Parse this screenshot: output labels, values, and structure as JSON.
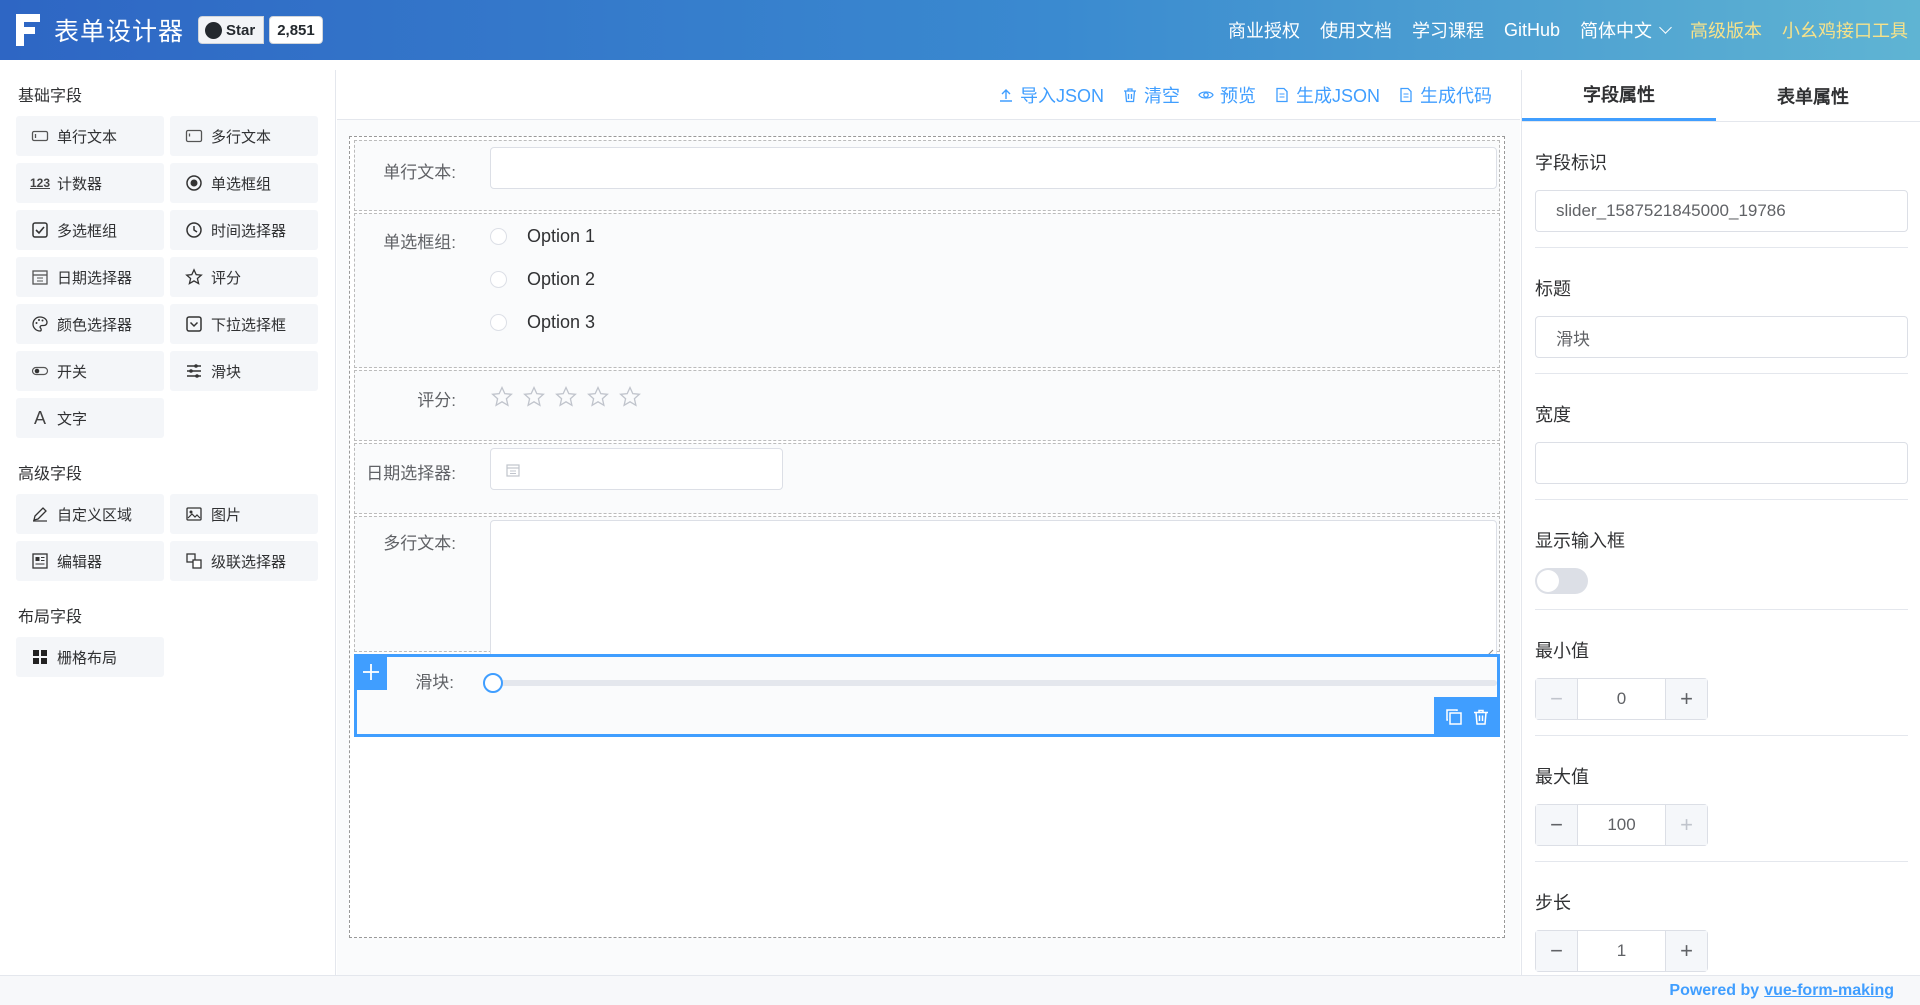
{
  "header": {
    "title": "表单设计器",
    "star_label": "Star",
    "star_count": "2,851",
    "nav": [
      "商业授权",
      "使用文档",
      "学习课程",
      "GitHub"
    ],
    "language": "简体中文",
    "advanced": "高级版本",
    "tool": "小幺鸡接口工具"
  },
  "left": {
    "basic_title": "基础字段",
    "basic": [
      {
        "label": "单行文本",
        "icon": "input-icon"
      },
      {
        "label": "多行文本",
        "icon": "textarea-icon"
      },
      {
        "label": "计数器",
        "icon": "number-icon"
      },
      {
        "label": "单选框组",
        "icon": "radio-icon"
      },
      {
        "label": "多选框组",
        "icon": "checkbox-icon"
      },
      {
        "label": "时间选择器",
        "icon": "clock-icon"
      },
      {
        "label": "日期选择器",
        "icon": "calendar-icon"
      },
      {
        "label": "评分",
        "icon": "star-icon"
      },
      {
        "label": "颜色选择器",
        "icon": "palette-icon"
      },
      {
        "label": "下拉选择框",
        "icon": "select-icon"
      },
      {
        "label": "开关",
        "icon": "switch-icon"
      },
      {
        "label": "滑块",
        "icon": "slider-icon"
      },
      {
        "label": "文字",
        "icon": "text-icon"
      }
    ],
    "advanced_title": "高级字段",
    "advanced": [
      {
        "label": "自定义区域",
        "icon": "custom-icon"
      },
      {
        "label": "图片",
        "icon": "image-icon"
      },
      {
        "label": "编辑器",
        "icon": "editor-icon"
      },
      {
        "label": "级联选择器",
        "icon": "cascader-icon"
      }
    ],
    "layout_title": "布局字段",
    "layout": [
      {
        "label": "栅格布局",
        "icon": "grid-icon"
      }
    ]
  },
  "toolbar": {
    "import": "导入JSON",
    "clear": "清空",
    "preview": "预览",
    "gen_json": "生成JSON",
    "gen_code": "生成代码"
  },
  "form": {
    "input_label": "单行文本:",
    "radio_label": "单选框组:",
    "radio_options": [
      "Option 1",
      "Option 2",
      "Option 3"
    ],
    "rate_label": "评分:",
    "rate_value": 0,
    "rate_max": 5,
    "date_label": "日期选择器:",
    "textarea_label": "多行文本:",
    "slider_label": "滑块:",
    "slider_value": 0
  },
  "right": {
    "tab_field": "字段属性",
    "tab_form": "表单属性",
    "id_label": "字段标识",
    "id_value": "slider_1587521845000_19786",
    "title_label": "标题",
    "title_value": "滑块",
    "width_label": "宽度",
    "width_value": "",
    "show_input_label": "显示输入框",
    "show_input_on": false,
    "min_label": "最小值",
    "min_value": "0",
    "max_label": "最大值",
    "max_value": "100",
    "step_label": "步长",
    "step_value": "1"
  },
  "footer": {
    "prefix": "Powered by",
    "link": "vue-form-making"
  },
  "colors": {
    "primary": "#409eff",
    "header_start": "#2e66c4",
    "header_end": "#5fb4d3",
    "gold": "#f7e28a"
  }
}
